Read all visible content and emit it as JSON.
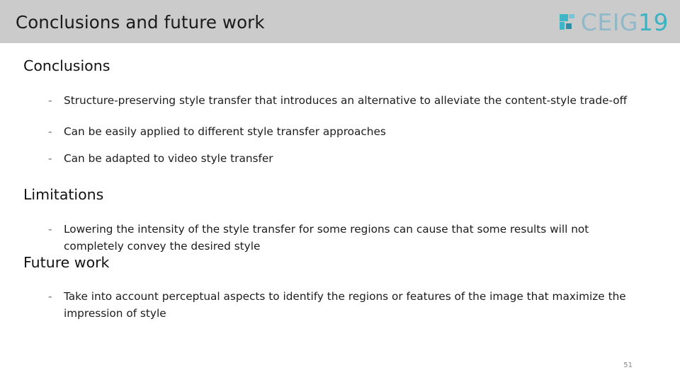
{
  "header": {
    "title": "Conclusions and future work",
    "background_color": "#cbcbcb",
    "logo": {
      "mark_name": "ceig-square-mark-icon",
      "text_primary": "CEIG",
      "text_accent": "19",
      "primary_color": "#8fb9c9",
      "accent_color": "#3ab4c4"
    }
  },
  "body": {
    "sections": [
      {
        "heading": "Conclusions",
        "bullets": [
          "Structure-preserving style transfer that introduces an alternative to alleviate the content-style trade-off",
          "Can be easily applied to different style transfer approaches",
          "Can be adapted to video style transfer"
        ]
      },
      {
        "heading": "Limitations",
        "bullets": [
          "Lowering the intensity of the style transfer for some regions can cause that some results will not completely convey the desired style"
        ]
      },
      {
        "heading": "Future work",
        "bullets": [
          "Take into account perceptual aspects to identify the regions or features of the image that maximize the impression of style"
        ]
      }
    ],
    "bullet_marker": "-"
  },
  "footer": {
    "page_number": "51"
  }
}
